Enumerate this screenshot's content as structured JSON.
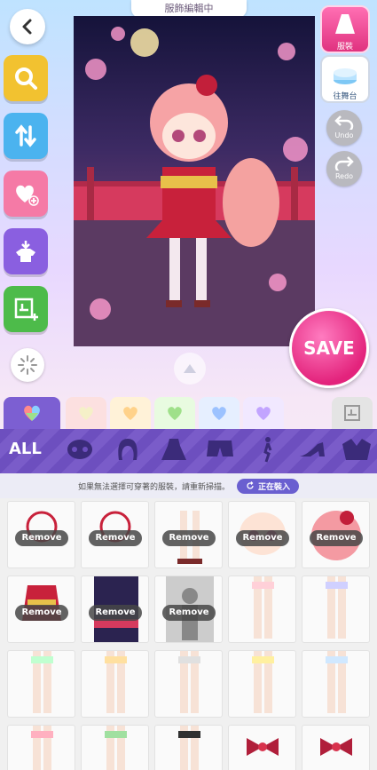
{
  "header": {
    "title": "服飾編輯中"
  },
  "toolbar_left": {
    "back": "back-arrow-icon",
    "items": [
      {
        "name": "search",
        "color": "#f2c230"
      },
      {
        "name": "sort",
        "color": "#4bb3ef"
      },
      {
        "name": "favorite-add",
        "color": "#f57aa6"
      },
      {
        "name": "wear",
        "color": "#8a5fe0"
      },
      {
        "name": "layout-add",
        "color": "#4dbb4a"
      }
    ]
  },
  "right_panel": {
    "costume_label": "服裝",
    "stage_label": "往舞台",
    "undo_label": "Undo",
    "redo_label": "Redo",
    "save_label": "SAVE"
  },
  "tabs": {
    "colors": [
      "#f5f0c8",
      "#ffe3b3",
      "#d8f5c8",
      "#d8e6ff",
      "#eadcff"
    ]
  },
  "category": {
    "all_label": "ALL",
    "items": [
      "face",
      "hair",
      "dress",
      "bottoms",
      "pose",
      "shoes",
      "accessory"
    ]
  },
  "info": {
    "message": "如果無法選擇可穿著的服裝，請重新掃描。",
    "loading": "正在裝入"
  },
  "grid": {
    "remove_label": "Remove",
    "cells": [
      {
        "type": "necklace",
        "worn": true
      },
      {
        "type": "sleeve",
        "worn": true
      },
      {
        "type": "shoes",
        "worn": true
      },
      {
        "type": "face",
        "worn": true
      },
      {
        "type": "hair",
        "worn": true
      },
      {
        "type": "kimono",
        "worn": true
      },
      {
        "type": "background",
        "worn": true
      },
      {
        "type": "silhouette",
        "worn": true
      },
      {
        "type": "legs",
        "worn": false
      },
      {
        "type": "legs",
        "worn": false
      },
      {
        "type": "legs",
        "worn": false
      },
      {
        "type": "legs",
        "worn": false
      },
      {
        "type": "legs",
        "worn": false
      },
      {
        "type": "legs",
        "worn": false
      },
      {
        "type": "legs",
        "worn": false
      },
      {
        "type": "legs",
        "worn": false
      },
      {
        "type": "legs",
        "worn": false
      },
      {
        "type": "legs",
        "worn": false
      },
      {
        "type": "bow",
        "worn": false
      },
      {
        "type": "bow",
        "worn": false
      },
      {
        "type": "bow",
        "worn": false
      },
      {
        "type": "bow",
        "worn": false
      },
      {
        "type": "bow",
        "worn": false
      }
    ]
  }
}
